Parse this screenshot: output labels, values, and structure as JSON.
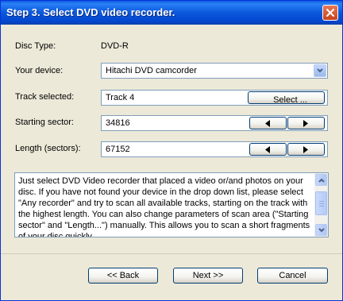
{
  "window": {
    "title": "Step 3. Select  DVD video recorder.",
    "close_icon": "close-icon"
  },
  "form": {
    "disc_type_label": "Disc Type:",
    "disc_type_value": "DVD-R",
    "device_label": "Your device:",
    "device_value": "Hitachi DVD camcorder",
    "track_label": "Track selected:",
    "track_value": "Track 4",
    "select_button": "Select ...",
    "start_label": "Starting sector:",
    "start_value": "34816",
    "length_label": "Length (sectors):",
    "length_value": "67152"
  },
  "info": {
    "text": "Just select DVD Video recorder that placed a video or/and photos on your disc. If you have not found your device in the drop down list, please select \"Any recorder\" and try to scan all available tracks, starting on the track with the highest length. You can also change parameters of scan area (\"Starting sector\" and \"Length...\") manually. This allows you to scan a short fragments of your disc quickly."
  },
  "buttons": {
    "back": "<< Back",
    "next": "Next >>",
    "cancel": "Cancel"
  },
  "colors": {
    "titlebar": "#0a58dd",
    "dialog_bg": "#ece9d8",
    "field_border": "#7f9db9"
  }
}
